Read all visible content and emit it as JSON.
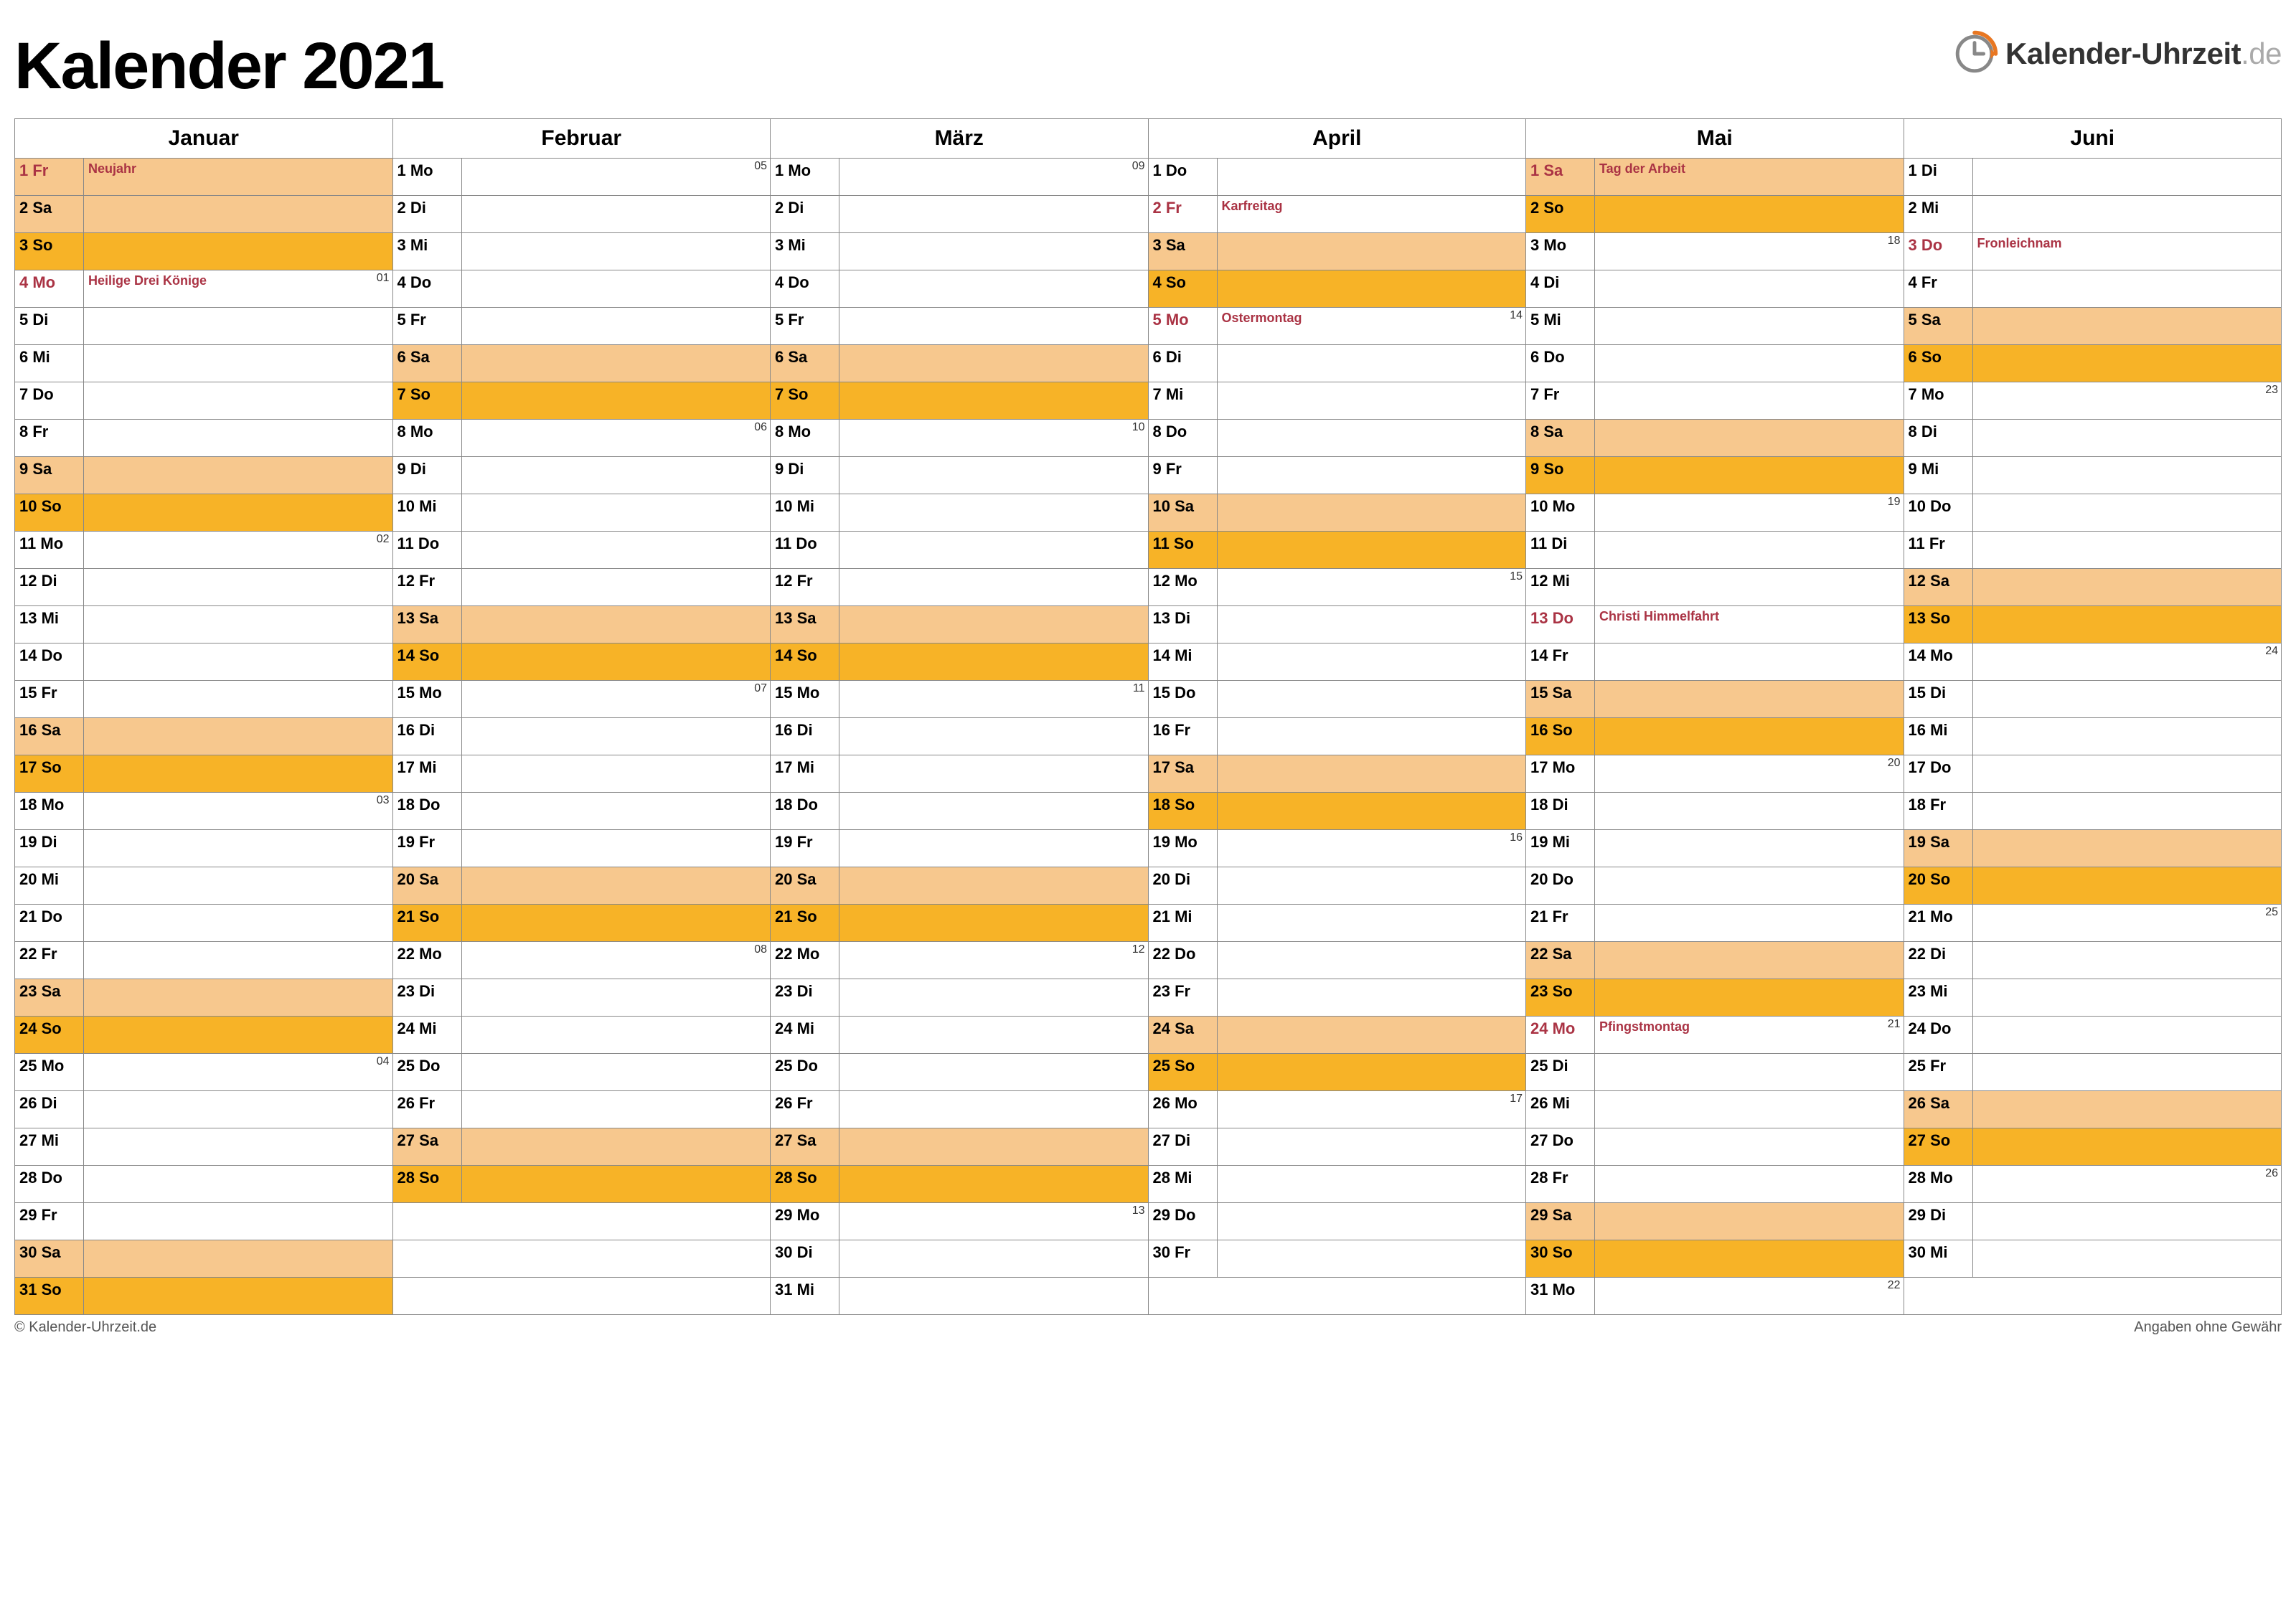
{
  "title": "Kalender 2021",
  "logo_text_1": "Kalender-Uhrzeit",
  "logo_text_2": ".de",
  "footer_left": "© Kalender-Uhrzeit.de",
  "footer_right": "Angaben ohne Gewähr",
  "months": [
    "Januar",
    "Februar",
    "März",
    "April",
    "Mai",
    "Juni"
  ],
  "weekdays": [
    "Mo",
    "Di",
    "Mi",
    "Do",
    "Fr",
    "Sa",
    "So"
  ],
  "days": {
    "Januar": [
      {
        "d": 1,
        "w": "Fr",
        "t": "hol",
        "h": "Neujahr"
      },
      {
        "d": 2,
        "w": "Sa",
        "t": "sat"
      },
      {
        "d": 3,
        "w": "So",
        "t": "sun"
      },
      {
        "d": 4,
        "w": "Mo",
        "t": "hol2",
        "h": "Heilige Drei Könige",
        "wk": "01"
      },
      {
        "d": 5,
        "w": "Di"
      },
      {
        "d": 6,
        "w": "Mi"
      },
      {
        "d": 7,
        "w": "Do"
      },
      {
        "d": 8,
        "w": "Fr"
      },
      {
        "d": 9,
        "w": "Sa",
        "t": "sat"
      },
      {
        "d": 10,
        "w": "So",
        "t": "sun"
      },
      {
        "d": 11,
        "w": "Mo",
        "wk": "02"
      },
      {
        "d": 12,
        "w": "Di"
      },
      {
        "d": 13,
        "w": "Mi"
      },
      {
        "d": 14,
        "w": "Do"
      },
      {
        "d": 15,
        "w": "Fr"
      },
      {
        "d": 16,
        "w": "Sa",
        "t": "sat"
      },
      {
        "d": 17,
        "w": "So",
        "t": "sun"
      },
      {
        "d": 18,
        "w": "Mo",
        "wk": "03"
      },
      {
        "d": 19,
        "w": "Di"
      },
      {
        "d": 20,
        "w": "Mi"
      },
      {
        "d": 21,
        "w": "Do"
      },
      {
        "d": 22,
        "w": "Fr"
      },
      {
        "d": 23,
        "w": "Sa",
        "t": "sat"
      },
      {
        "d": 24,
        "w": "So",
        "t": "sun"
      },
      {
        "d": 25,
        "w": "Mo",
        "wk": "04"
      },
      {
        "d": 26,
        "w": "Di"
      },
      {
        "d": 27,
        "w": "Mi"
      },
      {
        "d": 28,
        "w": "Do"
      },
      {
        "d": 29,
        "w": "Fr"
      },
      {
        "d": 30,
        "w": "Sa",
        "t": "sat"
      },
      {
        "d": 31,
        "w": "So",
        "t": "sun"
      }
    ],
    "Februar": [
      {
        "d": 1,
        "w": "Mo",
        "wk": "05"
      },
      {
        "d": 2,
        "w": "Di"
      },
      {
        "d": 3,
        "w": "Mi"
      },
      {
        "d": 4,
        "w": "Do"
      },
      {
        "d": 5,
        "w": "Fr"
      },
      {
        "d": 6,
        "w": "Sa",
        "t": "sat"
      },
      {
        "d": 7,
        "w": "So",
        "t": "sun"
      },
      {
        "d": 8,
        "w": "Mo",
        "wk": "06"
      },
      {
        "d": 9,
        "w": "Di"
      },
      {
        "d": 10,
        "w": "Mi"
      },
      {
        "d": 11,
        "w": "Do"
      },
      {
        "d": 12,
        "w": "Fr"
      },
      {
        "d": 13,
        "w": "Sa",
        "t": "sat"
      },
      {
        "d": 14,
        "w": "So",
        "t": "sun"
      },
      {
        "d": 15,
        "w": "Mo",
        "wk": "07"
      },
      {
        "d": 16,
        "w": "Di"
      },
      {
        "d": 17,
        "w": "Mi"
      },
      {
        "d": 18,
        "w": "Do"
      },
      {
        "d": 19,
        "w": "Fr"
      },
      {
        "d": 20,
        "w": "Sa",
        "t": "sat"
      },
      {
        "d": 21,
        "w": "So",
        "t": "sun"
      },
      {
        "d": 22,
        "w": "Mo",
        "wk": "08"
      },
      {
        "d": 23,
        "w": "Di"
      },
      {
        "d": 24,
        "w": "Mi"
      },
      {
        "d": 25,
        "w": "Do"
      },
      {
        "d": 26,
        "w": "Fr"
      },
      {
        "d": 27,
        "w": "Sa",
        "t": "sat"
      },
      {
        "d": 28,
        "w": "So",
        "t": "sun"
      }
    ],
    "März": [
      {
        "d": 1,
        "w": "Mo",
        "wk": "09"
      },
      {
        "d": 2,
        "w": "Di"
      },
      {
        "d": 3,
        "w": "Mi"
      },
      {
        "d": 4,
        "w": "Do"
      },
      {
        "d": 5,
        "w": "Fr"
      },
      {
        "d": 6,
        "w": "Sa",
        "t": "sat"
      },
      {
        "d": 7,
        "w": "So",
        "t": "sun"
      },
      {
        "d": 8,
        "w": "Mo",
        "wk": "10"
      },
      {
        "d": 9,
        "w": "Di"
      },
      {
        "d": 10,
        "w": "Mi"
      },
      {
        "d": 11,
        "w": "Do"
      },
      {
        "d": 12,
        "w": "Fr"
      },
      {
        "d": 13,
        "w": "Sa",
        "t": "sat"
      },
      {
        "d": 14,
        "w": "So",
        "t": "sun"
      },
      {
        "d": 15,
        "w": "Mo",
        "wk": "11"
      },
      {
        "d": 16,
        "w": "Di"
      },
      {
        "d": 17,
        "w": "Mi"
      },
      {
        "d": 18,
        "w": "Do"
      },
      {
        "d": 19,
        "w": "Fr"
      },
      {
        "d": 20,
        "w": "Sa",
        "t": "sat"
      },
      {
        "d": 21,
        "w": "So",
        "t": "sun"
      },
      {
        "d": 22,
        "w": "Mo",
        "wk": "12"
      },
      {
        "d": 23,
        "w": "Di"
      },
      {
        "d": 24,
        "w": "Mi"
      },
      {
        "d": 25,
        "w": "Do"
      },
      {
        "d": 26,
        "w": "Fr"
      },
      {
        "d": 27,
        "w": "Sa",
        "t": "sat"
      },
      {
        "d": 28,
        "w": "So",
        "t": "sun"
      },
      {
        "d": 29,
        "w": "Mo",
        "wk": "13"
      },
      {
        "d": 30,
        "w": "Di"
      },
      {
        "d": 31,
        "w": "Mi"
      }
    ],
    "April": [
      {
        "d": 1,
        "w": "Do"
      },
      {
        "d": 2,
        "w": "Fr",
        "t": "hol2",
        "h": "Karfreitag"
      },
      {
        "d": 3,
        "w": "Sa",
        "t": "sat"
      },
      {
        "d": 4,
        "w": "So",
        "t": "sun"
      },
      {
        "d": 5,
        "w": "Mo",
        "t": "hol2",
        "h": "Ostermontag",
        "wk": "14"
      },
      {
        "d": 6,
        "w": "Di"
      },
      {
        "d": 7,
        "w": "Mi"
      },
      {
        "d": 8,
        "w": "Do"
      },
      {
        "d": 9,
        "w": "Fr"
      },
      {
        "d": 10,
        "w": "Sa",
        "t": "sat"
      },
      {
        "d": 11,
        "w": "So",
        "t": "sun"
      },
      {
        "d": 12,
        "w": "Mo",
        "wk": "15"
      },
      {
        "d": 13,
        "w": "Di"
      },
      {
        "d": 14,
        "w": "Mi"
      },
      {
        "d": 15,
        "w": "Do"
      },
      {
        "d": 16,
        "w": "Fr"
      },
      {
        "d": 17,
        "w": "Sa",
        "t": "sat"
      },
      {
        "d": 18,
        "w": "So",
        "t": "sun"
      },
      {
        "d": 19,
        "w": "Mo",
        "wk": "16"
      },
      {
        "d": 20,
        "w": "Di"
      },
      {
        "d": 21,
        "w": "Mi"
      },
      {
        "d": 22,
        "w": "Do"
      },
      {
        "d": 23,
        "w": "Fr"
      },
      {
        "d": 24,
        "w": "Sa",
        "t": "sat"
      },
      {
        "d": 25,
        "w": "So",
        "t": "sun"
      },
      {
        "d": 26,
        "w": "Mo",
        "wk": "17"
      },
      {
        "d": 27,
        "w": "Di"
      },
      {
        "d": 28,
        "w": "Mi"
      },
      {
        "d": 29,
        "w": "Do"
      },
      {
        "d": 30,
        "w": "Fr"
      }
    ],
    "Mai": [
      {
        "d": 1,
        "w": "Sa",
        "t": "hol",
        "h": "Tag der Arbeit"
      },
      {
        "d": 2,
        "w": "So",
        "t": "sun"
      },
      {
        "d": 3,
        "w": "Mo",
        "wk": "18"
      },
      {
        "d": 4,
        "w": "Di"
      },
      {
        "d": 5,
        "w": "Mi"
      },
      {
        "d": 6,
        "w": "Do"
      },
      {
        "d": 7,
        "w": "Fr"
      },
      {
        "d": 8,
        "w": "Sa",
        "t": "sat"
      },
      {
        "d": 9,
        "w": "So",
        "t": "sun"
      },
      {
        "d": 10,
        "w": "Mo",
        "wk": "19"
      },
      {
        "d": 11,
        "w": "Di"
      },
      {
        "d": 12,
        "w": "Mi"
      },
      {
        "d": 13,
        "w": "Do",
        "t": "hol2",
        "h": "Christi Himmelfahrt"
      },
      {
        "d": 14,
        "w": "Fr"
      },
      {
        "d": 15,
        "w": "Sa",
        "t": "sat"
      },
      {
        "d": 16,
        "w": "So",
        "t": "sun"
      },
      {
        "d": 17,
        "w": "Mo",
        "wk": "20"
      },
      {
        "d": 18,
        "w": "Di"
      },
      {
        "d": 19,
        "w": "Mi"
      },
      {
        "d": 20,
        "w": "Do"
      },
      {
        "d": 21,
        "w": "Fr"
      },
      {
        "d": 22,
        "w": "Sa",
        "t": "sat"
      },
      {
        "d": 23,
        "w": "So",
        "t": "sun"
      },
      {
        "d": 24,
        "w": "Mo",
        "t": "hol2",
        "h": "Pfingstmontag",
        "wk": "21"
      },
      {
        "d": 25,
        "w": "Di"
      },
      {
        "d": 26,
        "w": "Mi"
      },
      {
        "d": 27,
        "w": "Do"
      },
      {
        "d": 28,
        "w": "Fr"
      },
      {
        "d": 29,
        "w": "Sa",
        "t": "sat"
      },
      {
        "d": 30,
        "w": "So",
        "t": "sun"
      },
      {
        "d": 31,
        "w": "Mo",
        "wk": "22"
      }
    ],
    "Juni": [
      {
        "d": 1,
        "w": "Di"
      },
      {
        "d": 2,
        "w": "Mi"
      },
      {
        "d": 3,
        "w": "Do",
        "t": "hol2",
        "h": "Fronleichnam"
      },
      {
        "d": 4,
        "w": "Fr"
      },
      {
        "d": 5,
        "w": "Sa",
        "t": "sat"
      },
      {
        "d": 6,
        "w": "So",
        "t": "sun"
      },
      {
        "d": 7,
        "w": "Mo",
        "wk": "23"
      },
      {
        "d": 8,
        "w": "Di"
      },
      {
        "d": 9,
        "w": "Mi"
      },
      {
        "d": 10,
        "w": "Do"
      },
      {
        "d": 11,
        "w": "Fr"
      },
      {
        "d": 12,
        "w": "Sa",
        "t": "sat"
      },
      {
        "d": 13,
        "w": "So",
        "t": "sun"
      },
      {
        "d": 14,
        "w": "Mo",
        "wk": "24"
      },
      {
        "d": 15,
        "w": "Di"
      },
      {
        "d": 16,
        "w": "Mi"
      },
      {
        "d": 17,
        "w": "Do"
      },
      {
        "d": 18,
        "w": "Fr"
      },
      {
        "d": 19,
        "w": "Sa",
        "t": "sat"
      },
      {
        "d": 20,
        "w": "So",
        "t": "sun"
      },
      {
        "d": 21,
        "w": "Mo",
        "wk": "25"
      },
      {
        "d": 22,
        "w": "Di"
      },
      {
        "d": 23,
        "w": "Mi"
      },
      {
        "d": 24,
        "w": "Do"
      },
      {
        "d": 25,
        "w": "Fr"
      },
      {
        "d": 26,
        "w": "Sa",
        "t": "sat"
      },
      {
        "d": 27,
        "w": "So",
        "t": "sun"
      },
      {
        "d": 28,
        "w": "Mo",
        "wk": "26"
      },
      {
        "d": 29,
        "w": "Di"
      },
      {
        "d": 30,
        "w": "Mi"
      }
    ]
  }
}
